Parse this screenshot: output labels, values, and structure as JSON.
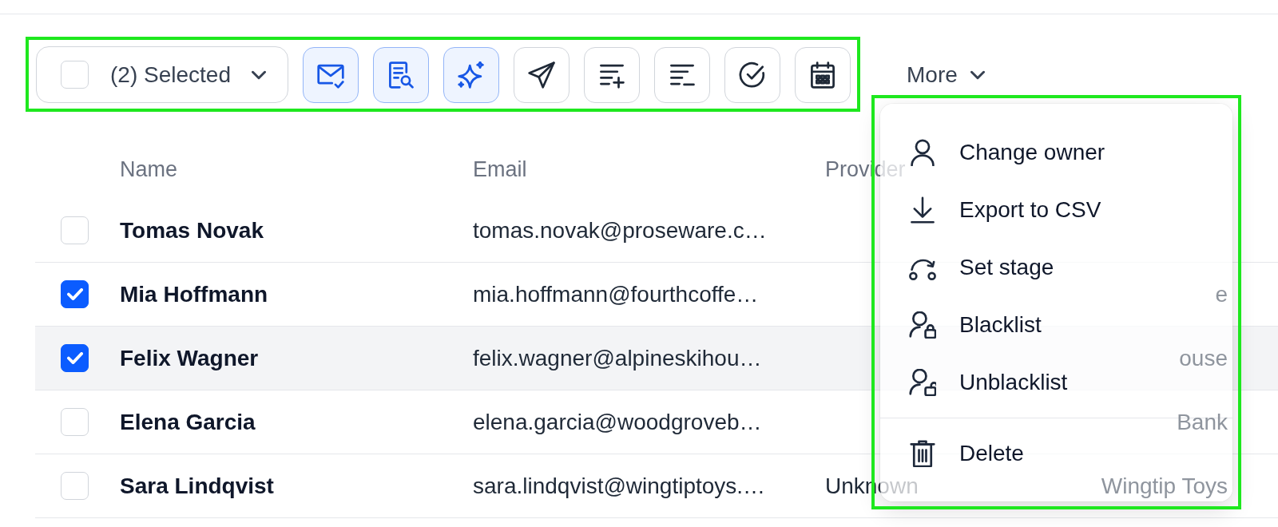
{
  "toolbar": {
    "selection": {
      "checked": false,
      "label": "(2) Selected"
    },
    "actions": [
      {
        "active": true
      },
      {
        "active": true
      },
      {
        "active": true
      },
      {
        "active": false
      },
      {
        "active": false
      },
      {
        "active": false
      },
      {
        "active": false
      },
      {
        "active": false
      }
    ],
    "more": {
      "label": "More",
      "expanded": true,
      "menu": {
        "sections": [
          {
            "items": [
              {
                "label": "Change owner"
              },
              {
                "label": "Export to CSV"
              },
              {
                "label": "Set stage"
              },
              {
                "label": "Blacklist"
              },
              {
                "label": "Unblacklist"
              }
            ]
          },
          {
            "items": [
              {
                "label": "Delete"
              }
            ]
          }
        ]
      }
    }
  },
  "table": {
    "columns": [
      "Name",
      "Email",
      "Provider"
    ],
    "rows": [
      {
        "checked": false,
        "hovered": false,
        "name": "Tomas Novak",
        "email": "tomas.novak@proseware.c…"
      },
      {
        "checked": true,
        "hovered": false,
        "name": "Mia Hoffmann",
        "email": "mia.hoffmann@fourthcoffe…",
        "column_4": "e"
      },
      {
        "checked": true,
        "hovered": true,
        "name": "Felix Wagner",
        "email": "felix.wagner@alpineskihou…",
        "column_4": "ouse"
      },
      {
        "checked": false,
        "hovered": false,
        "name": "Elena Garcia",
        "email": "elena.garcia@woodgroveb…",
        "column_4": "Bank"
      },
      {
        "checked": false,
        "hovered": false,
        "name": "Sara Lindqvist",
        "email": "sara.lindqvist@wingtiptoys.…",
        "provider": "Unknown",
        "column_4": "Wingtip Toys"
      }
    ]
  }
}
